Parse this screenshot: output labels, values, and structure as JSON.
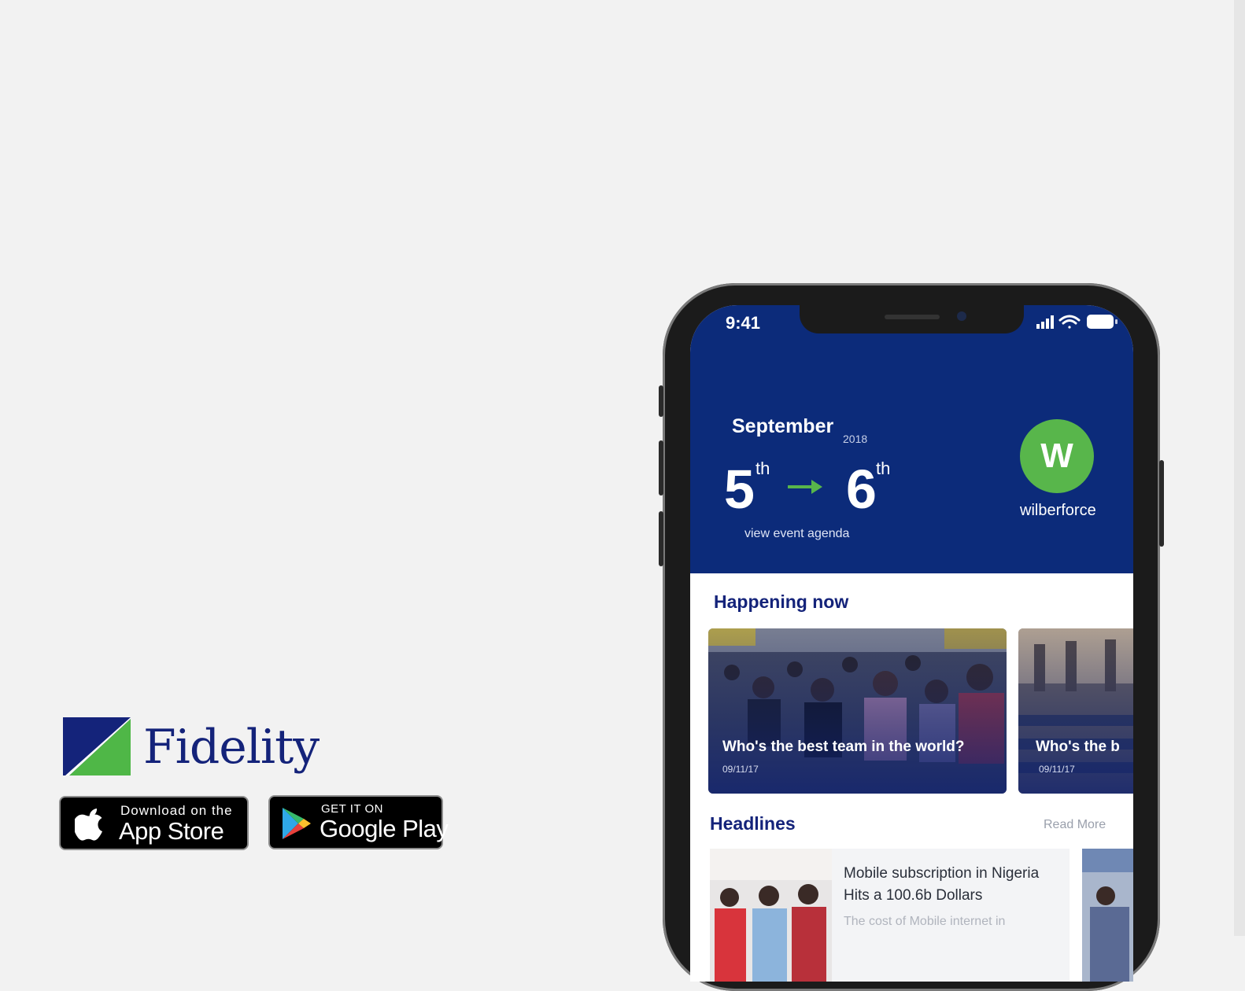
{
  "brand": {
    "name": "Fidelity",
    "colors": {
      "navy": "#14237a",
      "green": "#4fb747"
    }
  },
  "store_badges": {
    "app_store": {
      "small_text": "Download on the",
      "large_text": "App Store",
      "icon": "apple-icon"
    },
    "google_play": {
      "small_text": "GET IT ON",
      "large_text": "Google Play",
      "icon": "google-play-icon"
    }
  },
  "phone": {
    "status_bar": {
      "time": "9:41",
      "icons": [
        "signal-icon",
        "wifi-icon",
        "battery-icon"
      ]
    },
    "event": {
      "month": "September",
      "year": "2018",
      "start_day": "5",
      "start_suffix": "th",
      "end_day": "6",
      "end_suffix": "th",
      "agenda_link": "view event agenda"
    },
    "user": {
      "initial": "W",
      "name": "wilberforce"
    },
    "happening_now": {
      "title": "Happening now",
      "cards": [
        {
          "title": "Who's the best team in the world?",
          "date": "09/11/17"
        },
        {
          "title": "Who's the b",
          "date": "09/11/17"
        }
      ]
    },
    "headlines": {
      "title": "Headlines",
      "read_more": "Read More",
      "items": [
        {
          "title": "Mobile subscription in Nigeria Hits a 100.6b Dollars",
          "excerpt": "The cost of Mobile internet in"
        }
      ]
    },
    "colors": {
      "hero_bg": "#0c2b7a",
      "avatar_bg": "#58b64b",
      "arrow": "#58b64b"
    }
  }
}
